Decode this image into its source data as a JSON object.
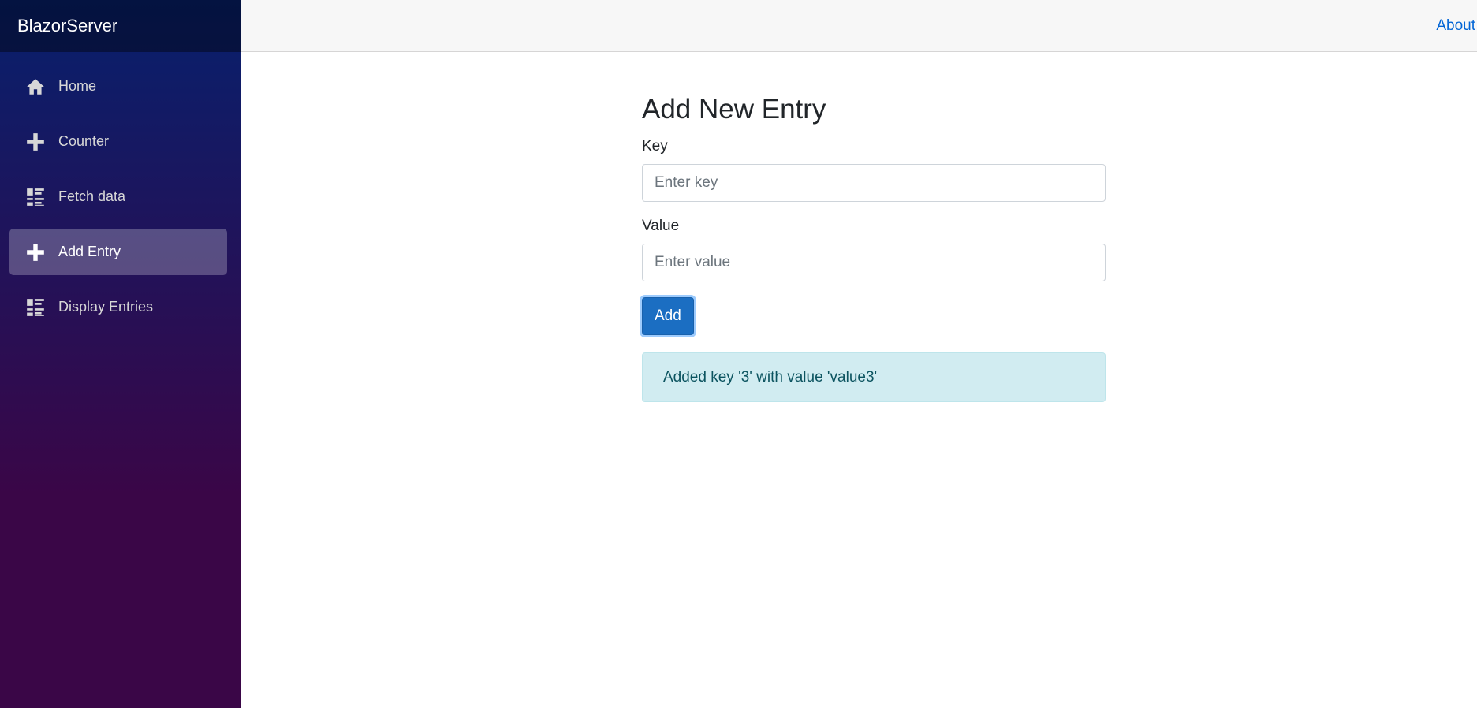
{
  "app": {
    "brand": "BlazorServer"
  },
  "sidebar": {
    "items": [
      {
        "label": "Home",
        "icon": "home-icon",
        "active": false
      },
      {
        "label": "Counter",
        "icon": "plus-icon",
        "active": false
      },
      {
        "label": "Fetch data",
        "icon": "list-icon",
        "active": false
      },
      {
        "label": "Add Entry",
        "icon": "plus-icon",
        "active": true
      },
      {
        "label": "Display Entries",
        "icon": "list-icon",
        "active": false
      }
    ]
  },
  "header": {
    "about_label": "About"
  },
  "main": {
    "title": "Add New Entry",
    "key_label": "Key",
    "key_placeholder": "Enter key",
    "key_value": "",
    "value_label": "Value",
    "value_placeholder": "Enter value",
    "value_value": "",
    "add_button_label": "Add",
    "status_message": "Added key '3' with value 'value3'"
  },
  "colors": {
    "sidebar_top": "#07206d",
    "sidebar_bottom": "#3a0647",
    "primary_button": "#1b6ec2",
    "alert_bg": "#d1ecf1",
    "alert_text": "#0c5460",
    "link": "#0366d6"
  }
}
